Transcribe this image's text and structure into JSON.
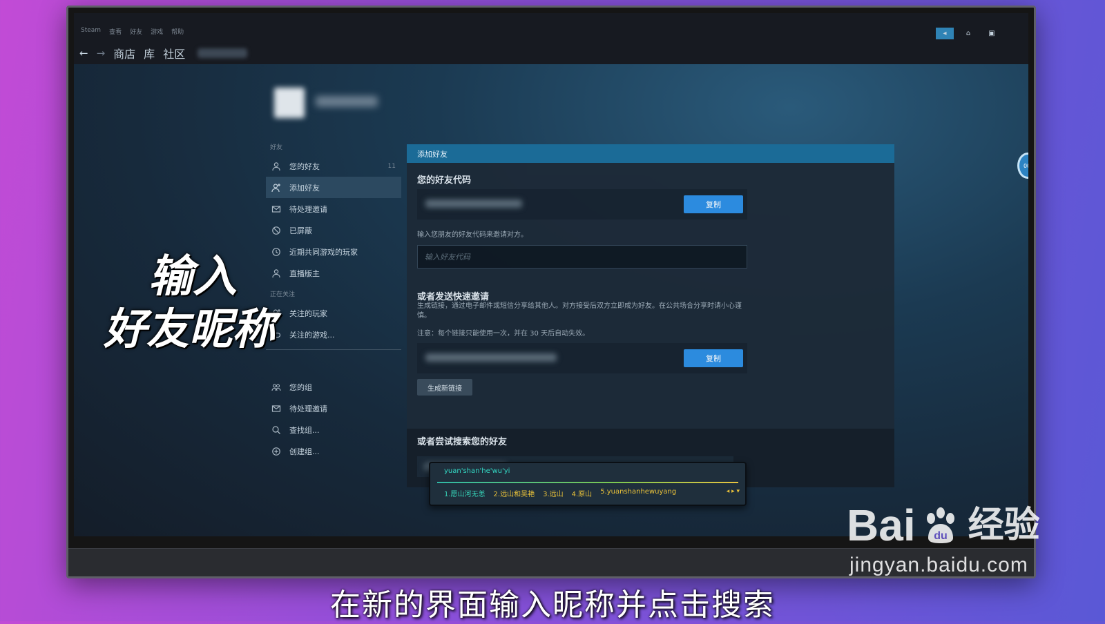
{
  "topmenu": [
    "Steam",
    "查看",
    "好友",
    "游戏",
    "帮助"
  ],
  "nav": {
    "back": "←",
    "forward": "→",
    "store": "商店",
    "library": "库",
    "community": "社区"
  },
  "window_controls": {
    "broadcast": "◂",
    "notifications": "⌂",
    "friends_chat": "▣"
  },
  "sidebar": {
    "friends_section": "好友",
    "items": [
      {
        "label": "您的好友",
        "icon": "person-icon",
        "count": "11"
      },
      {
        "label": "添加好友",
        "icon": "add-person-icon",
        "active": true
      },
      {
        "label": "待处理邀请",
        "icon": "envelope-icon"
      },
      {
        "label": "已屏蔽",
        "icon": "blocked-icon"
      },
      {
        "label": "近期共同游戏的玩家",
        "icon": "clock-icon"
      },
      {
        "label": "直播版主",
        "icon": "person-icon"
      }
    ],
    "following_section": "正在关注",
    "following_items": [
      {
        "label": "关注的玩家",
        "icon": "add-person-icon"
      },
      {
        "label": "关注的游戏...",
        "icon": "gamepad-icon"
      }
    ],
    "group_items": [
      {
        "label": "您的组",
        "icon": "group-icon"
      },
      {
        "label": "待处理邀请",
        "icon": "envelope-icon"
      },
      {
        "label": "查找组...",
        "icon": "search-icon"
      },
      {
        "label": "创建组...",
        "icon": "plus-circle-icon"
      }
    ]
  },
  "panel": {
    "header": "添加好友",
    "friend_code_title": "您的好友代码",
    "copy_label": "复制",
    "invite_hint": "输入您朋友的好友代码来邀请对方。",
    "code_placeholder": "输入好友代码",
    "quick_invite_title": "或者发送快速邀请",
    "quick_invite_desc": "生成链接，通过电子邮件或短信分享给其他人。对方接受后双方立即成为好友。在公共场合分享时请小心谨慎。",
    "quick_invite_note": "注意：每个链接只能使用一次，并在 30 天后自动失效。",
    "copy_label_2": "复制",
    "generate_label": "生成新链接",
    "search_title": "或者尝试搜索您的好友"
  },
  "ime": {
    "composition": "yuan'shan'he'wu'yi",
    "candidates": [
      "1.愿山河无恙",
      "2.远山和吴艳",
      "3.远山",
      "4.原山",
      "5.yuanshanhewuyang"
    ],
    "nav": "◂ ▸ ▾"
  },
  "timer": "00:",
  "overlay": {
    "line1": "输入",
    "line2": "好友昵称"
  },
  "subtitle": "在新的界面输入昵称并点击搜索",
  "watermark": {
    "brand_a": "Bai",
    "brand_b": "经验",
    "url": "jingyan.baidu.com"
  }
}
